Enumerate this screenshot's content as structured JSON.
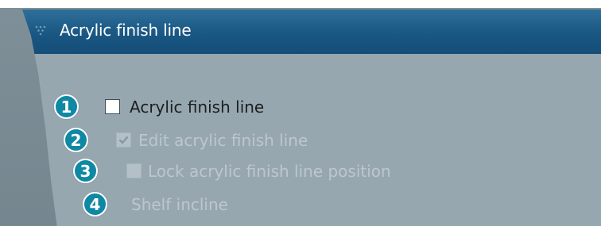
{
  "header": {
    "title": "Acrylic finish line"
  },
  "options": [
    {
      "badge": "1",
      "label": "Acrylic finish line",
      "checked": false,
      "enabled": true
    },
    {
      "badge": "2",
      "label": "Edit acrylic finish line",
      "checked": true,
      "enabled": false
    },
    {
      "badge": "3",
      "label": "Lock acrylic finish line position",
      "checked": false,
      "enabled": false
    },
    {
      "badge": "4",
      "label": "Shelf incline",
      "enabled": false
    }
  ],
  "colors": {
    "header": "#1a5783",
    "body": "#97a7b0",
    "badge": "#0f88a4"
  }
}
